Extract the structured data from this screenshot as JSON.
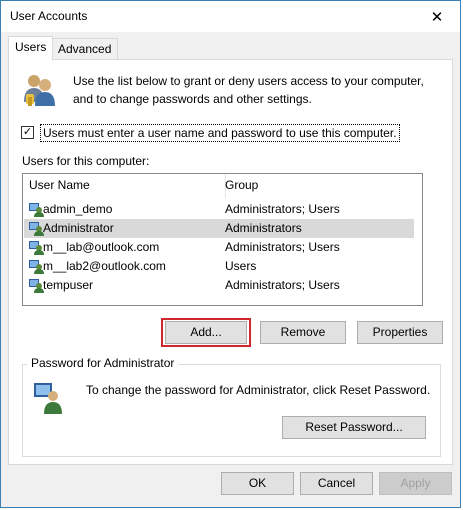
{
  "window": {
    "title": "User Accounts"
  },
  "tabs": [
    {
      "label": "Users"
    },
    {
      "label": "Advanced"
    }
  ],
  "intro_text": "Use the list below to grant or deny users access to your computer, and to change passwords and other settings.",
  "checkbox": {
    "label": "Users must enter a user name and password to use this computer.",
    "checked": true
  },
  "users_label": "Users for this computer:",
  "table": {
    "columns": [
      "User Name",
      "Group"
    ],
    "rows": [
      {
        "name": "admin_demo",
        "group": "Administrators; Users"
      },
      {
        "name": "Administrator",
        "group": "Administrators",
        "selected": true
      },
      {
        "name": "m__lab@outlook.com",
        "group": "Administrators; Users"
      },
      {
        "name": "m__lab2@outlook.com",
        "group": "Users"
      },
      {
        "name": "tempuser",
        "group": "Administrators; Users"
      }
    ]
  },
  "buttons": {
    "add": "Add...",
    "remove": "Remove",
    "properties": "Properties",
    "reset_password": "Reset Password...",
    "ok": "OK",
    "cancel": "Cancel",
    "apply": "Apply"
  },
  "password_group": {
    "title": "Password for Administrator",
    "text": "To change the password for Administrator, click Reset Password."
  },
  "colors": {
    "highlight": "#d0272d",
    "selected_row": "#d9d9d9",
    "window_border": "#3c7fb1"
  }
}
